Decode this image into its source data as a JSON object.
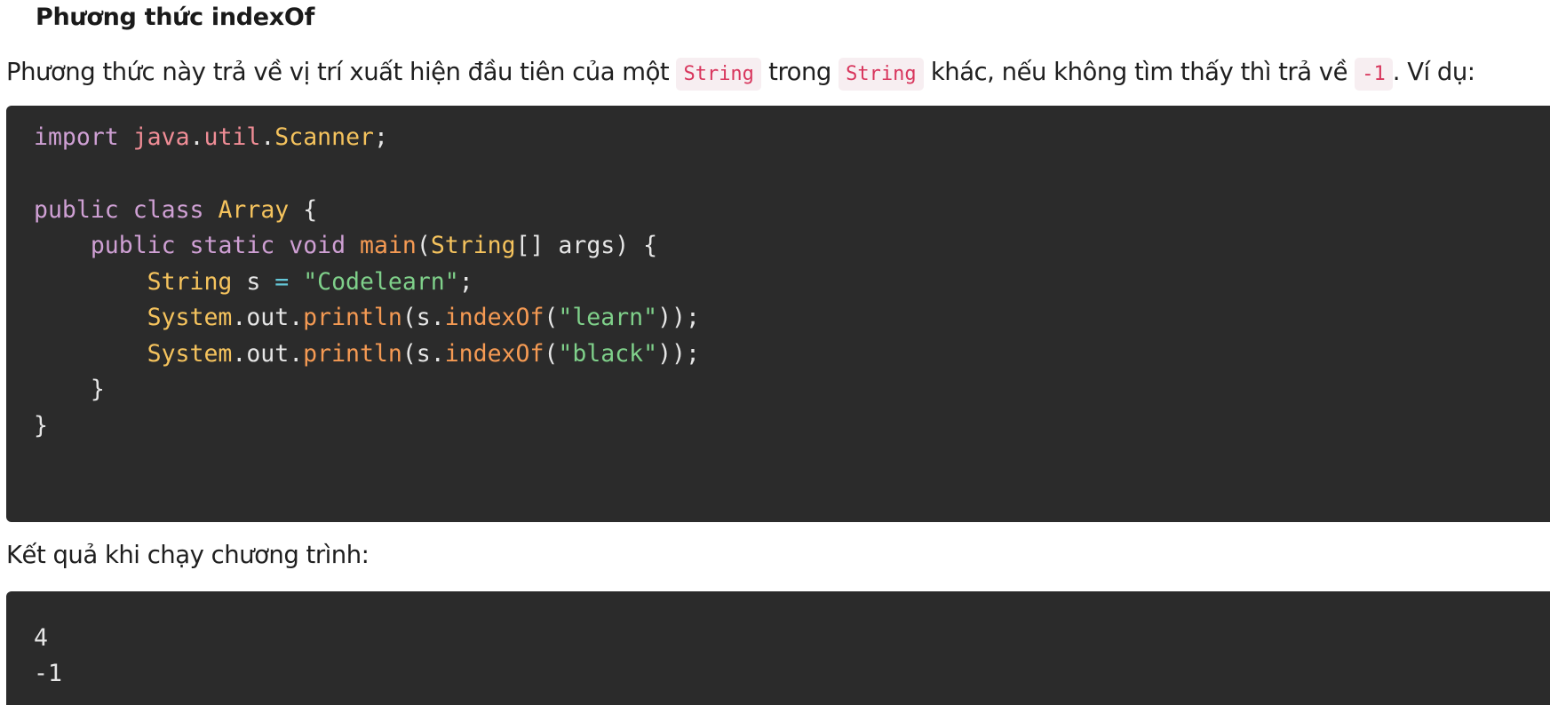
{
  "heading": "Phương thức indexOf",
  "intro": {
    "part1": "Phương thức này trả về vị trí xuất hiện đầu tiên của một ",
    "code1": "String",
    "part2": " trong ",
    "code2": "String",
    "part3": " khác, nếu không tìm thấy thì trả về ",
    "code3": "-1",
    "part4": ". Ví dụ:"
  },
  "code": {
    "line1": {
      "kw": "import",
      "pkg1": "java",
      "dot1": ".",
      "pkg2": "util",
      "dot2": ".",
      "type": "Scanner",
      "end": ";"
    },
    "line3": {
      "kw1": "public",
      "kw2": "class",
      "type": "Array",
      "end": "{"
    },
    "line4": {
      "kw1": "public",
      "kw2": "static",
      "kw3": "void",
      "fn": "main",
      "p1": "(",
      "type": "String",
      "p2": "[] args) {"
    },
    "line5": {
      "type": "String",
      "var": " s ",
      "op": "=",
      "str": "\"Codelearn\"",
      "end": ";"
    },
    "line6": {
      "type": "System",
      "mid": ".out.",
      "fn1": "println",
      "p1": "(s.",
      "fn2": "indexOf",
      "p2": "(",
      "str": "\"learn\"",
      "end": "));"
    },
    "line7": {
      "type": "System",
      "mid": ".out.",
      "fn1": "println",
      "p1": "(s.",
      "fn2": "indexOf",
      "p2": "(",
      "str": "\"black\"",
      "end": "));"
    },
    "line8": "}",
    "line9": "}"
  },
  "result_label": "Kết quả khi chạy chương trình:",
  "output": [
    "4",
    "-1"
  ]
}
